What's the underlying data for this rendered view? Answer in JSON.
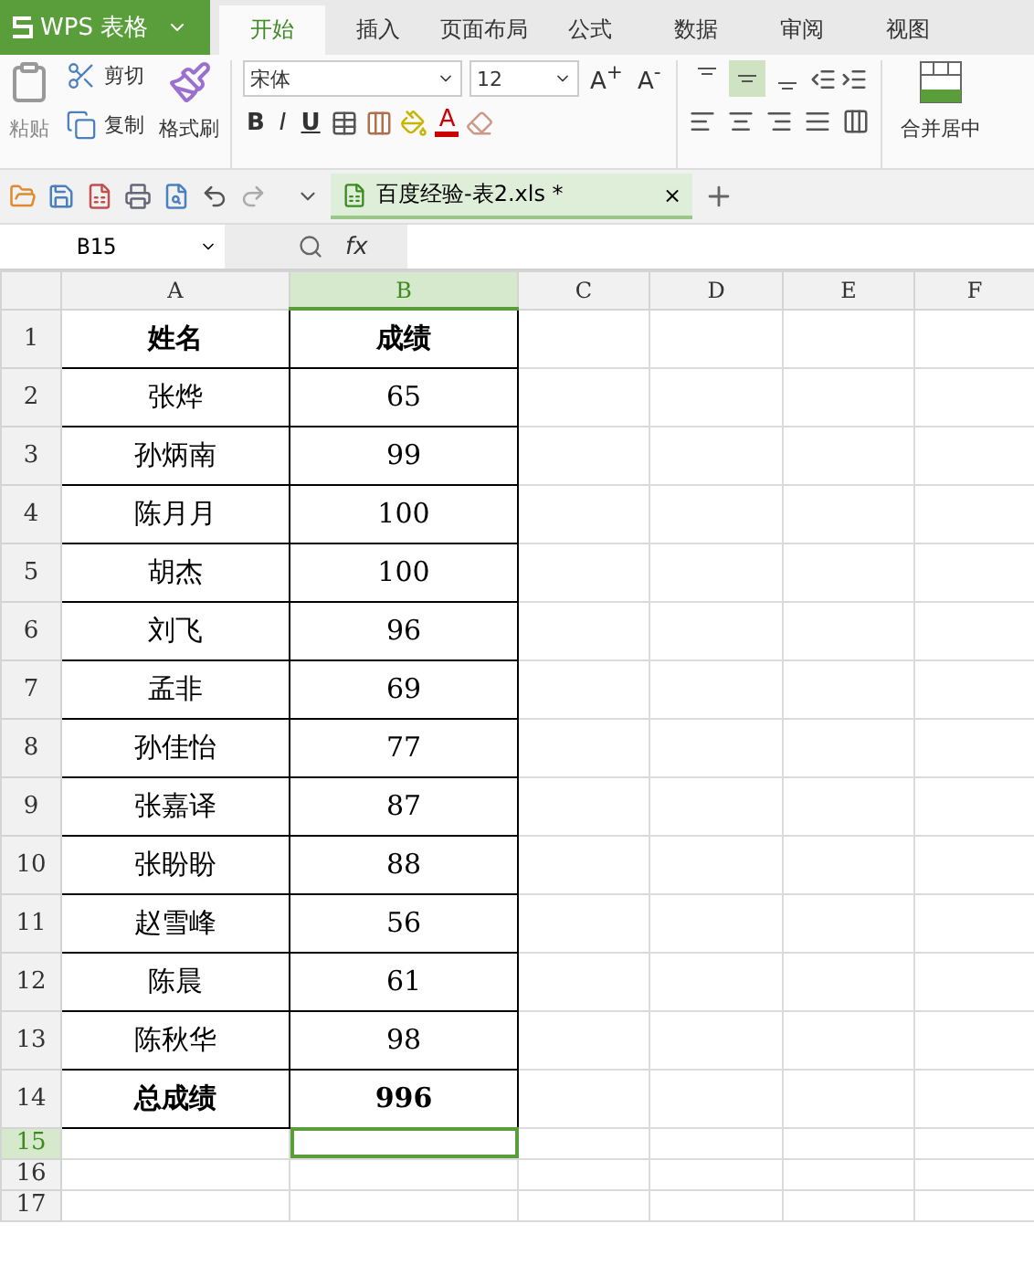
{
  "app": {
    "title": "WPS 表格"
  },
  "tabs": [
    {
      "label": "开始",
      "selected": true
    },
    {
      "label": "插入",
      "selected": false
    },
    {
      "label": "页面布局",
      "selected": false
    },
    {
      "label": "公式",
      "selected": false
    },
    {
      "label": "数据",
      "selected": false
    },
    {
      "label": "审阅",
      "selected": false
    },
    {
      "label": "视图",
      "selected": false
    }
  ],
  "ribbon": {
    "paste": "粘贴",
    "cut": "剪切",
    "copy": "复制",
    "format_painter": "格式刷",
    "font_name": "宋体",
    "font_size": "12",
    "grow_font": "A$^{+}$",
    "shrink_font": "A$^{-}$",
    "bold": "B",
    "italic": "I",
    "underline": "U",
    "font_color": "A",
    "merge": "合并居中",
    "align_top": [
      {
        "kind": "top",
        "selected": false
      },
      {
        "kind": "middle",
        "selected": true
      },
      {
        "kind": "bottom",
        "selected": false
      }
    ]
  },
  "document_tab": {
    "title": "百度经验-表2.xls *",
    "close": "×"
  },
  "name_box": "B15",
  "formula_label": "fx",
  "columns": [
    {
      "label": "A",
      "selected": false
    },
    {
      "label": "B",
      "selected": true
    },
    {
      "label": "C",
      "selected": false
    },
    {
      "label": "D",
      "selected": false
    },
    {
      "label": "E",
      "selected": false
    },
    {
      "label": "F",
      "selected": false
    }
  ],
  "rows": [
    {
      "number": "1",
      "cells": [
        "姓名",
        "成绩"
      ],
      "bold": true,
      "selected": false
    },
    {
      "number": "2",
      "cells": [
        "张烨",
        "65"
      ],
      "bold": false,
      "selected": false
    },
    {
      "number": "3",
      "cells": [
        "孙炳南",
        "99"
      ],
      "bold": false,
      "selected": false
    },
    {
      "number": "4",
      "cells": [
        "陈月月",
        "100"
      ],
      "bold": false,
      "selected": false
    },
    {
      "number": "5",
      "cells": [
        "胡杰",
        "100"
      ],
      "bold": false,
      "selected": false
    },
    {
      "number": "6",
      "cells": [
        "刘飞",
        "96"
      ],
      "bold": false,
      "selected": false
    },
    {
      "number": "7",
      "cells": [
        "孟非",
        "69"
      ],
      "bold": false,
      "selected": false
    },
    {
      "number": "8",
      "cells": [
        "孙佳怡",
        "77"
      ],
      "bold": false,
      "selected": false
    },
    {
      "number": "9",
      "cells": [
        "张嘉译",
        "87"
      ],
      "bold": false,
      "selected": false
    },
    {
      "number": "10",
      "cells": [
        "张盼盼",
        "88"
      ],
      "bold": false,
      "selected": false
    },
    {
      "number": "11",
      "cells": [
        "赵雪峰",
        "56"
      ],
      "bold": false,
      "selected": false
    },
    {
      "number": "12",
      "cells": [
        "陈晨",
        "61"
      ],
      "bold": false,
      "selected": false
    },
    {
      "number": "13",
      "cells": [
        "陈秋华",
        "98"
      ],
      "bold": false,
      "selected": false
    },
    {
      "number": "14",
      "cells": [
        "总成绩",
        "996"
      ],
      "bold": true,
      "selected": false
    },
    {
      "number": "15",
      "cells": [],
      "selected": true
    },
    {
      "number": "16",
      "cells": [],
      "selected": false
    },
    {
      "number": "17",
      "cells": [],
      "selected": false
    }
  ]
}
